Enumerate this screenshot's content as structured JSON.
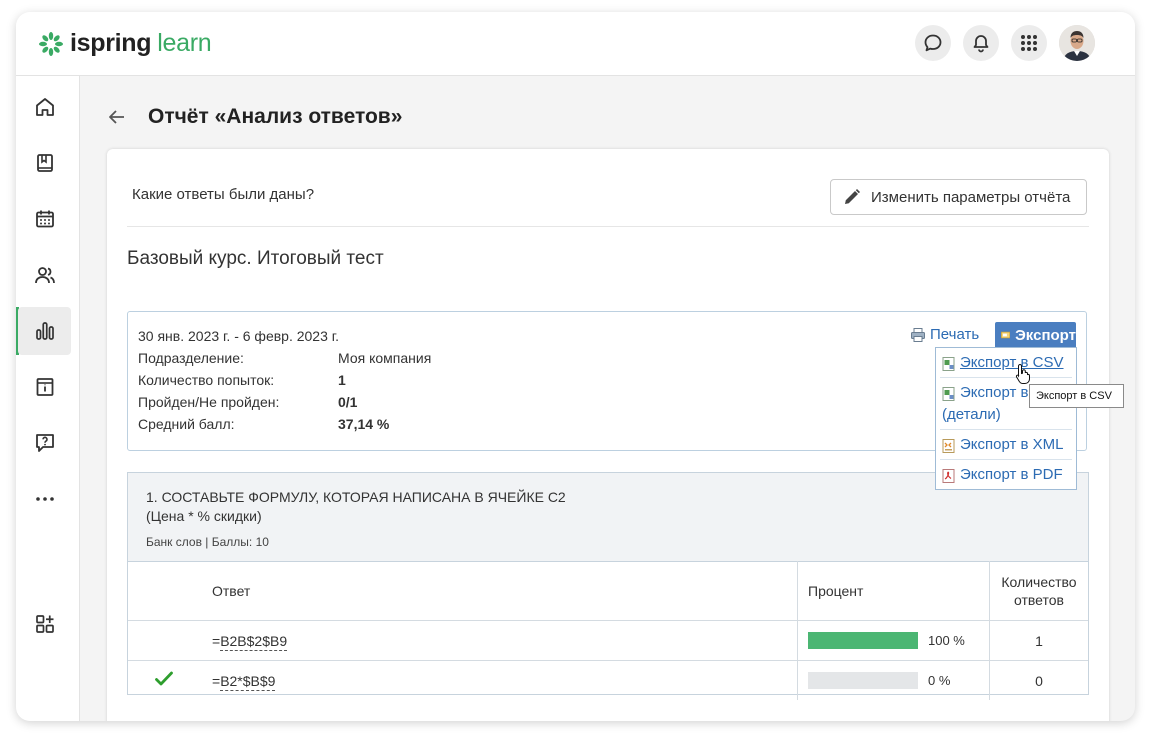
{
  "app": {
    "logo_part1": "ispring",
    "logo_part2": "learn"
  },
  "header": {
    "icons": [
      "chat-icon",
      "bell-icon",
      "apps-grid-icon"
    ],
    "avatar": "user-avatar"
  },
  "sidebar": {
    "items": [
      "home-icon",
      "book-icon",
      "calendar-icon",
      "users-icon",
      "reports-icon",
      "info-icon",
      "help-icon",
      "more-icon",
      "add-widget-icon"
    ],
    "active": "reports-icon"
  },
  "page": {
    "title": "Отчёт «Анализ ответов»"
  },
  "report": {
    "question_label": "Какие ответы были даны?",
    "edit_button": "Изменить параметры отчёта",
    "course_title": "Базовый курс. Итоговый тест",
    "date_range": "30 янв. 2023 г. - 6 февр. 2023 г.",
    "info": [
      {
        "key": "Подразделение:",
        "value": "Моя компания"
      },
      {
        "key": "Количество попыток:",
        "value": "1"
      },
      {
        "key": "Пройден/Не пройден:",
        "value": "0/1"
      },
      {
        "key": "Средний балл:",
        "value": "37,14 %"
      }
    ],
    "print_label": "Печать",
    "export_label": "Экспорт"
  },
  "export_menu": {
    "items": [
      {
        "label": "Экспорт в CSV",
        "icon": "csv-icon"
      },
      {
        "label": "Экспорт в",
        "label2": "(детали)",
        "icon": "csv-icon"
      },
      {
        "label": "Экспорт в XML",
        "icon": "xml-icon"
      },
      {
        "label": "Экспорт в PDF",
        "icon": "pdf-icon"
      }
    ],
    "tooltip": "Экспорт в CSV"
  },
  "question": {
    "title_line1": "1. СОСТАВЬТЕ ФОРМУЛУ, КОТОРАЯ НАПИСАНА В ЯЧЕЙКЕ С2",
    "title_line2": "(Цена * % скидки)",
    "meta": "Банк слов | Баллы: 10",
    "columns": [
      "Ответ",
      "Процент",
      "Количество ответов"
    ],
    "rows": [
      {
        "correct": false,
        "prefix": "=",
        "answer": "B2B$2$B9",
        "percent": 100,
        "percent_label": "100 %",
        "count": "1"
      },
      {
        "correct": true,
        "prefix": "=",
        "answer": "B2*$B$9",
        "percent": 0,
        "percent_label": "0 %",
        "count": "0"
      }
    ]
  },
  "colors": {
    "accent": "#3aaa64",
    "link": "#2c6bb3",
    "export_button": "#4a7ec0",
    "bar_fill": "#4bb673"
  }
}
